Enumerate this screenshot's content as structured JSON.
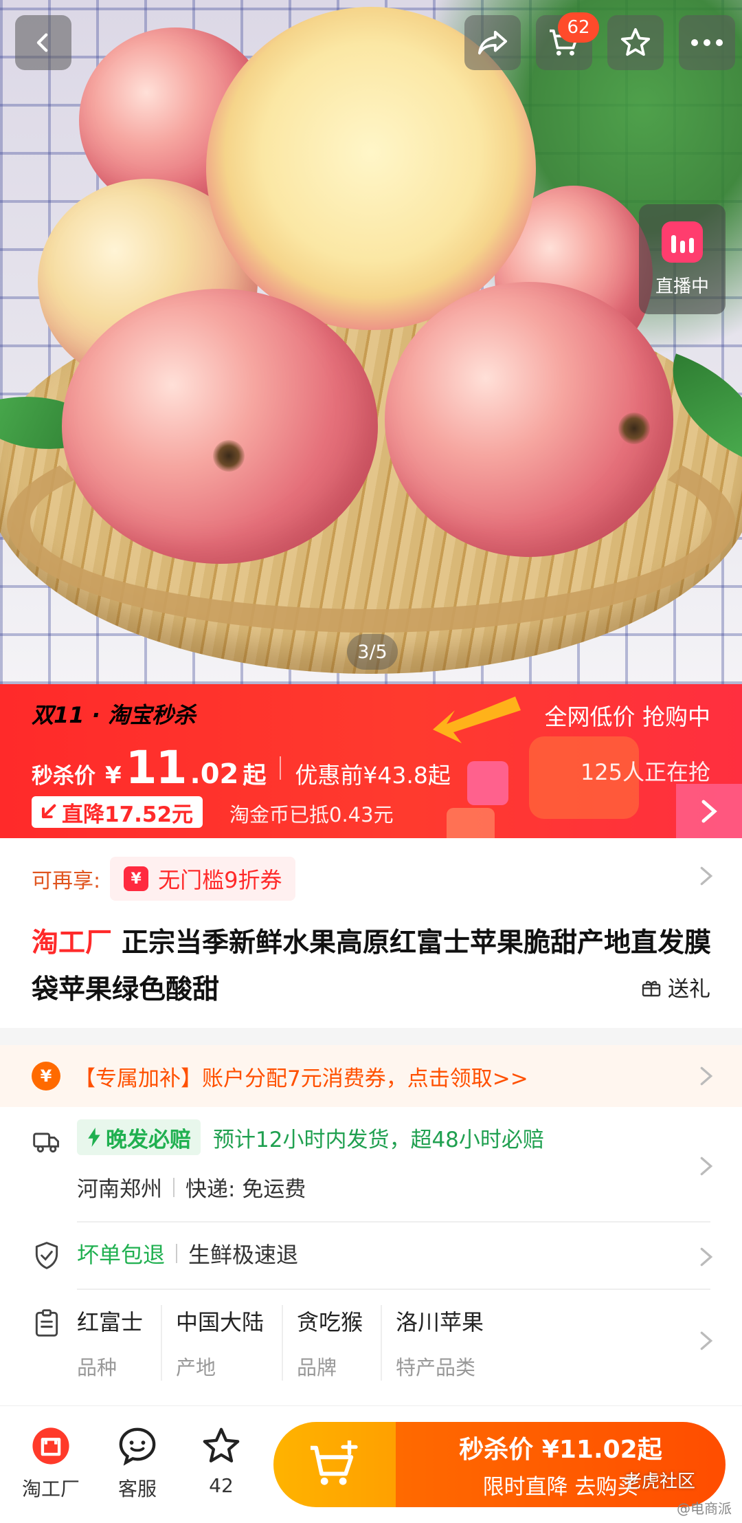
{
  "top_nav": {
    "cart_count": "62"
  },
  "live": {
    "label": "直播中"
  },
  "gallery": {
    "pager": "3/5"
  },
  "promo": {
    "brand": "双11 · 淘宝秒杀",
    "right_top": "全网低价 抢购中",
    "price_label": "秒杀价",
    "currency": "¥",
    "price_int": "11",
    "price_dec": ".02",
    "price_suffix": "起",
    "orig_label": "优惠前¥43.8起",
    "grab_count": "125人正在抢",
    "drop_label": "直降17.52元",
    "coin_note": "淘金币已抵0.43元"
  },
  "coupon": {
    "label": "可再享:",
    "chip": "无门槛9折券",
    "chip_icon": "¥"
  },
  "product": {
    "brand": "淘工厂",
    "title": "正宗当季新鲜水果高原红富士苹果脆甜产地直发膜袋苹果绿色酸甜",
    "gift": "送礼"
  },
  "subsidy": {
    "icon": "¥",
    "text": "【专属加补】账户分配7元消费券，点击领取>>"
  },
  "shipping": {
    "tag": "晚发必赔",
    "message": "预计12小时内发货，超48小时必赔",
    "location": "河南郑州",
    "express": "快递: 免运费"
  },
  "returns": {
    "tag": "坏单包退",
    "desc": "生鲜极速退"
  },
  "attributes": [
    {
      "value": "红富士",
      "key": "品种"
    },
    {
      "value": "中国大陆",
      "key": "产地"
    },
    {
      "value": "贪吃猴",
      "key": "品牌"
    },
    {
      "value": "洛川苹果",
      "key": "特产品类"
    }
  ],
  "bottom": {
    "factory": "淘工厂",
    "service": "客服",
    "fav_count": "42",
    "cta_line1": "秒杀价 ¥11.02起",
    "cta_line2": "限时直降  去购买"
  },
  "watermark": {
    "main": "老虎社区",
    "sub": "@电商派"
  },
  "colors": {
    "accent": "#ff2a2a",
    "green": "#20b050",
    "orange": "#ff5000"
  }
}
